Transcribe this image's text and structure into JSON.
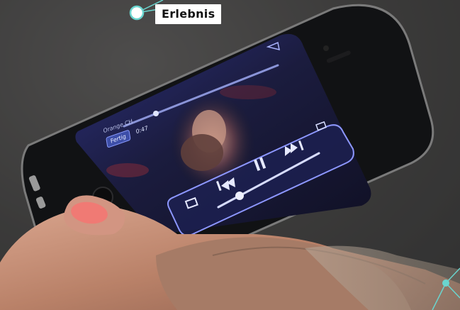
{
  "label": {
    "text": "Erlebnis"
  },
  "player": {
    "carrier": "Orange CH",
    "done_label": "Fertig",
    "elapsed": "0:47"
  },
  "icons": {
    "play_pause": "pause-icon",
    "prev": "skip-back-icon",
    "next": "skip-forward-icon",
    "airplay": "airplay-icon",
    "dock": "book-icon",
    "scale": "fullscreen-icon"
  },
  "colors": {
    "accent": "#6ad5cf",
    "ui_glow": "#7d8cff",
    "thumb": "#ff7a78"
  }
}
